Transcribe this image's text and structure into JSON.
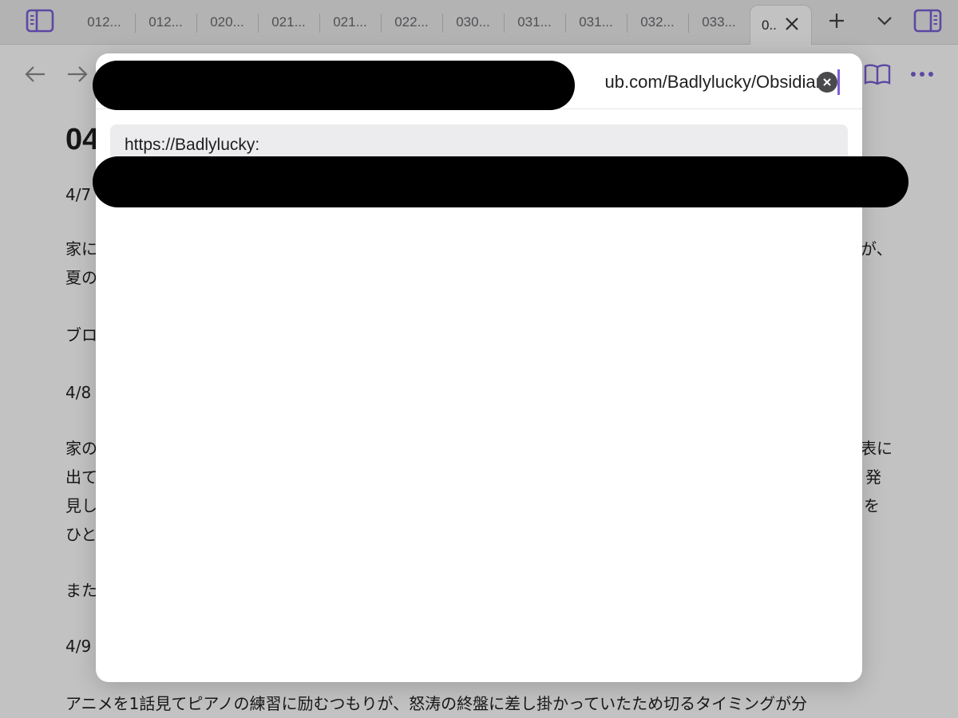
{
  "tabbar": {
    "tabs": [
      "012...",
      "012...",
      "020...",
      "021...",
      "021...",
      "022...",
      "030...",
      "031...",
      "031...",
      "032...",
      "033..."
    ],
    "active_tab": "0..",
    "left_icon": "sidebar-left-icon",
    "right_icon": "sidebar-right-icon",
    "new_tab_icon": "plus-icon",
    "tab_list_icon": "chevron-down-icon"
  },
  "nav": {
    "back_icon": "arrow-left-icon",
    "forward_icon": "arrow-right-icon",
    "reading_icon": "book-icon",
    "more_icon": "more-horizontal-icon"
  },
  "document": {
    "title_fragment": "04",
    "lines": [
      "4/7",
      "家に",
      "夏の",
      "ブロ",
      "4/8",
      "家の",
      "出て",
      "見し",
      "ひと",
      "また",
      "4/9",
      "アニメを1話見てピアノの練習に励むつもりが、怒涛の終盤に差し掛かっていたため切るタイミングが分"
    ],
    "right_fragments": [
      "が、",
      "表に",
      "発",
      "を"
    ]
  },
  "modal": {
    "input_value": "ub.com/Badlylucky/Obsidian.",
    "clear_icon": "clear-icon",
    "suggestion_text": "https://Badlylucky:"
  },
  "colors": {
    "accent": "#7b5fd6",
    "tabbar_bg": "#ebebed",
    "redaction": "#000000"
  }
}
